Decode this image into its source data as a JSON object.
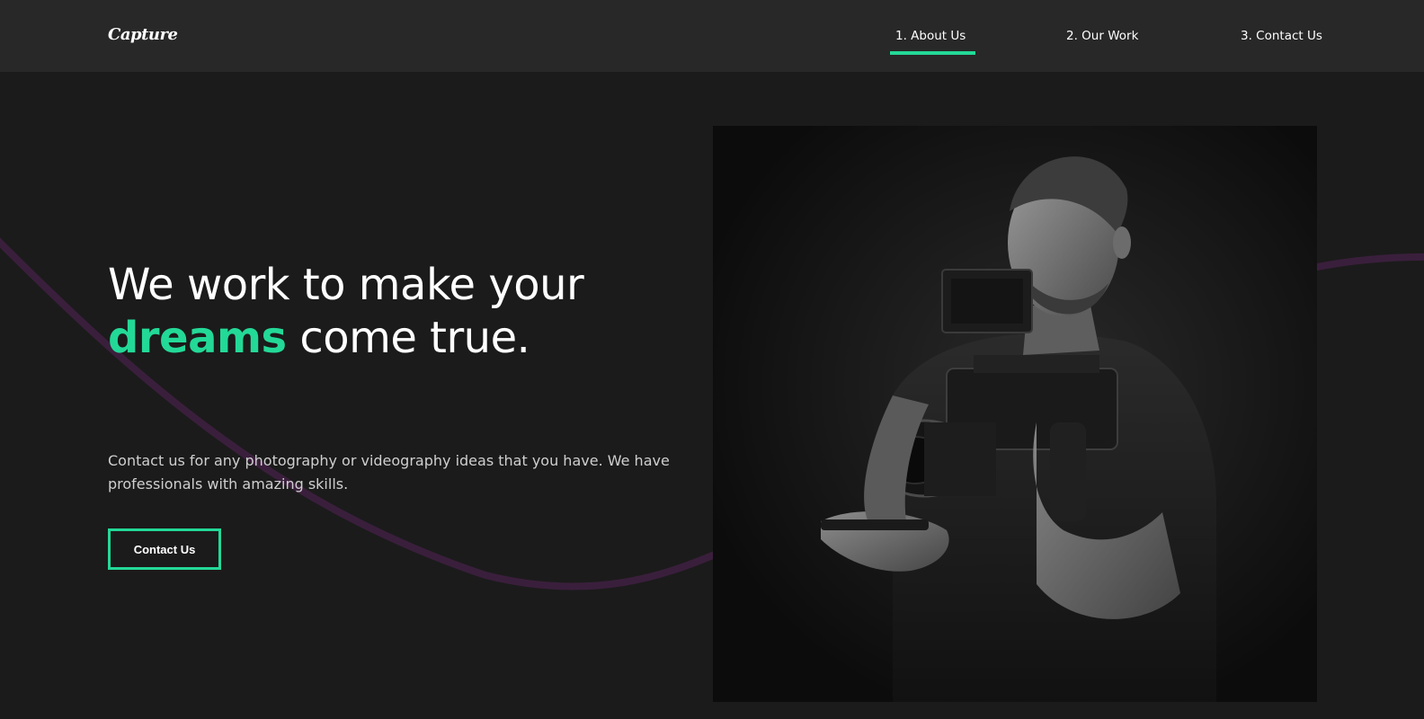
{
  "brand": {
    "logo": "Capture"
  },
  "nav": {
    "items": [
      {
        "label": "1. About Us",
        "active": true
      },
      {
        "label": "2. Our Work",
        "active": false
      },
      {
        "label": "3. Contact Us",
        "active": false
      }
    ]
  },
  "hero": {
    "title_before": "We work to make your ",
    "title_accent": "dreams",
    "title_after": " come true.",
    "description": "Contact us for any photography or videography ideas that you have. We have professionals with amazing skills.",
    "cta_label": "Contact Us",
    "image_subject": "photographer-with-camera"
  },
  "colors": {
    "background": "#1b1b1b",
    "navbar": "#282828",
    "accent": "#23d997",
    "wave": "#3a1f3c"
  }
}
